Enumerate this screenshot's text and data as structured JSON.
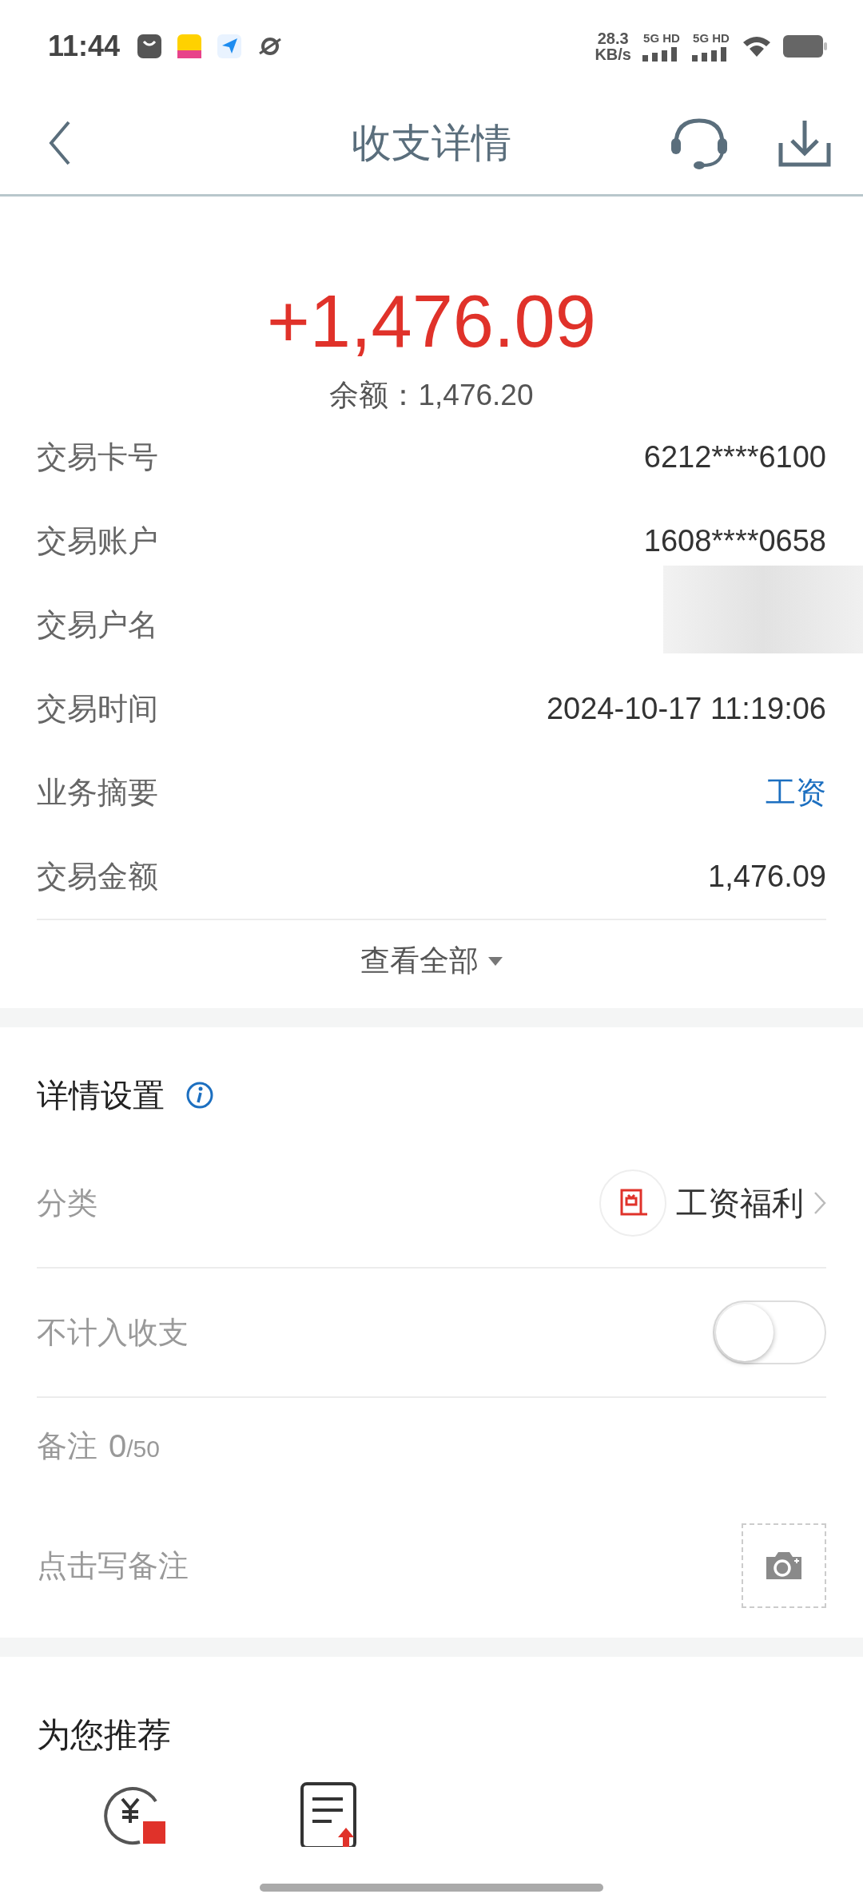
{
  "status_bar": {
    "time": "11:44",
    "net_speed": "28.3",
    "net_unit": "KB/s",
    "sim_1": "5G HD",
    "sim_2": "5G HD"
  },
  "header": {
    "title": "收支详情"
  },
  "summary": {
    "amount": "+1,476.09",
    "balance": "余额：1,476.20"
  },
  "details": [
    {
      "label": "交易卡号",
      "value": "6212****6100",
      "kind": "plain"
    },
    {
      "label": "交易账户",
      "value": "1608****0658",
      "kind": "plain"
    },
    {
      "label": "交易户名",
      "kind": "masked"
    },
    {
      "label": "交易时间",
      "value": "2024-10-17 11:19:06",
      "kind": "plain"
    },
    {
      "label": "业务摘要",
      "value": "工资",
      "kind": "link"
    },
    {
      "label": "交易金额",
      "value": "1,476.09",
      "kind": "plain"
    }
  ],
  "view_all": "查看全部",
  "settings": {
    "title": "详情设置",
    "category": {
      "label": "分类",
      "value": "工资福利"
    },
    "exclude": {
      "label": "不计入收支",
      "on": false
    },
    "note": {
      "label": "备注",
      "count": "0",
      "limit": "/50",
      "placeholder": "点击写备注"
    }
  },
  "recommend": {
    "title": "为您推荐"
  }
}
